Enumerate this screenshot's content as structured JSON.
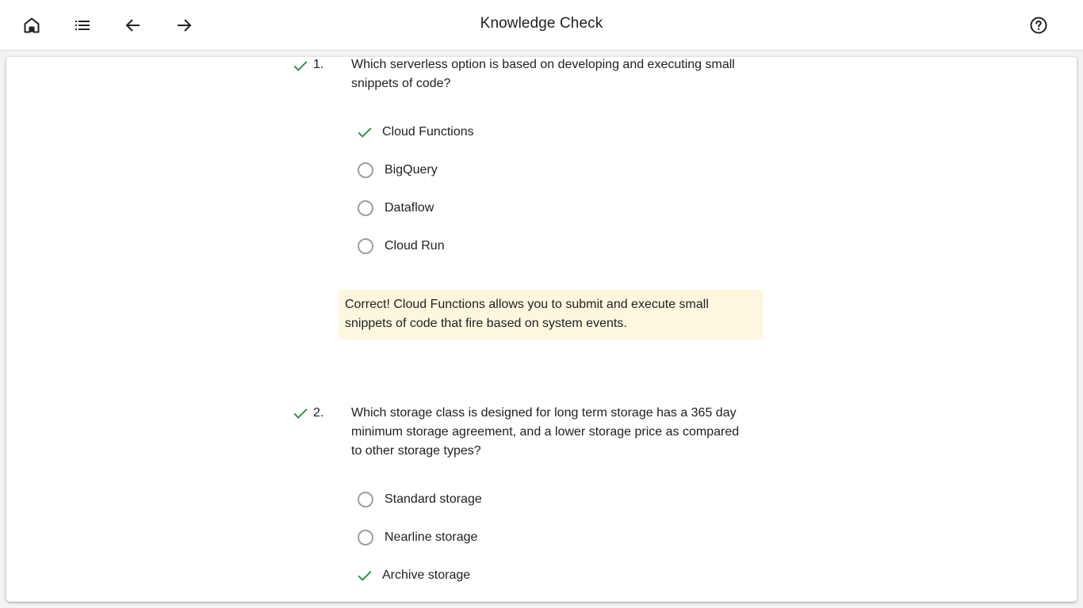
{
  "header": {
    "title": "Knowledge Check",
    "icons": [
      "home-icon",
      "list-icon",
      "arrow-back-icon",
      "arrow-forward-icon",
      "help-icon"
    ]
  },
  "colors": {
    "check": "#1e8e3e",
    "feedback_bg": "#fef7e0",
    "radio_border": "#9aa0a6"
  },
  "questions": [
    {
      "number": "1.",
      "text": "Which serverless option is based on developing and executing small snippets of code?",
      "options": [
        {
          "label": "Cloud Functions",
          "selected": true
        },
        {
          "label": "BigQuery",
          "selected": false
        },
        {
          "label": "Dataflow",
          "selected": false
        },
        {
          "label": "Cloud Run",
          "selected": false
        }
      ],
      "feedback": "Correct! Cloud Functions allows you to submit and execute small snippets of code that fire based on system events."
    },
    {
      "number": "2.",
      "text": "Which storage class is designed for long term storage has a 365 day minimum storage agreement, and a lower storage price as compared to other storage types?",
      "options": [
        {
          "label": "Standard storage",
          "selected": false
        },
        {
          "label": "Nearline storage",
          "selected": false
        },
        {
          "label": "Archive storage",
          "selected": true
        }
      ]
    }
  ]
}
